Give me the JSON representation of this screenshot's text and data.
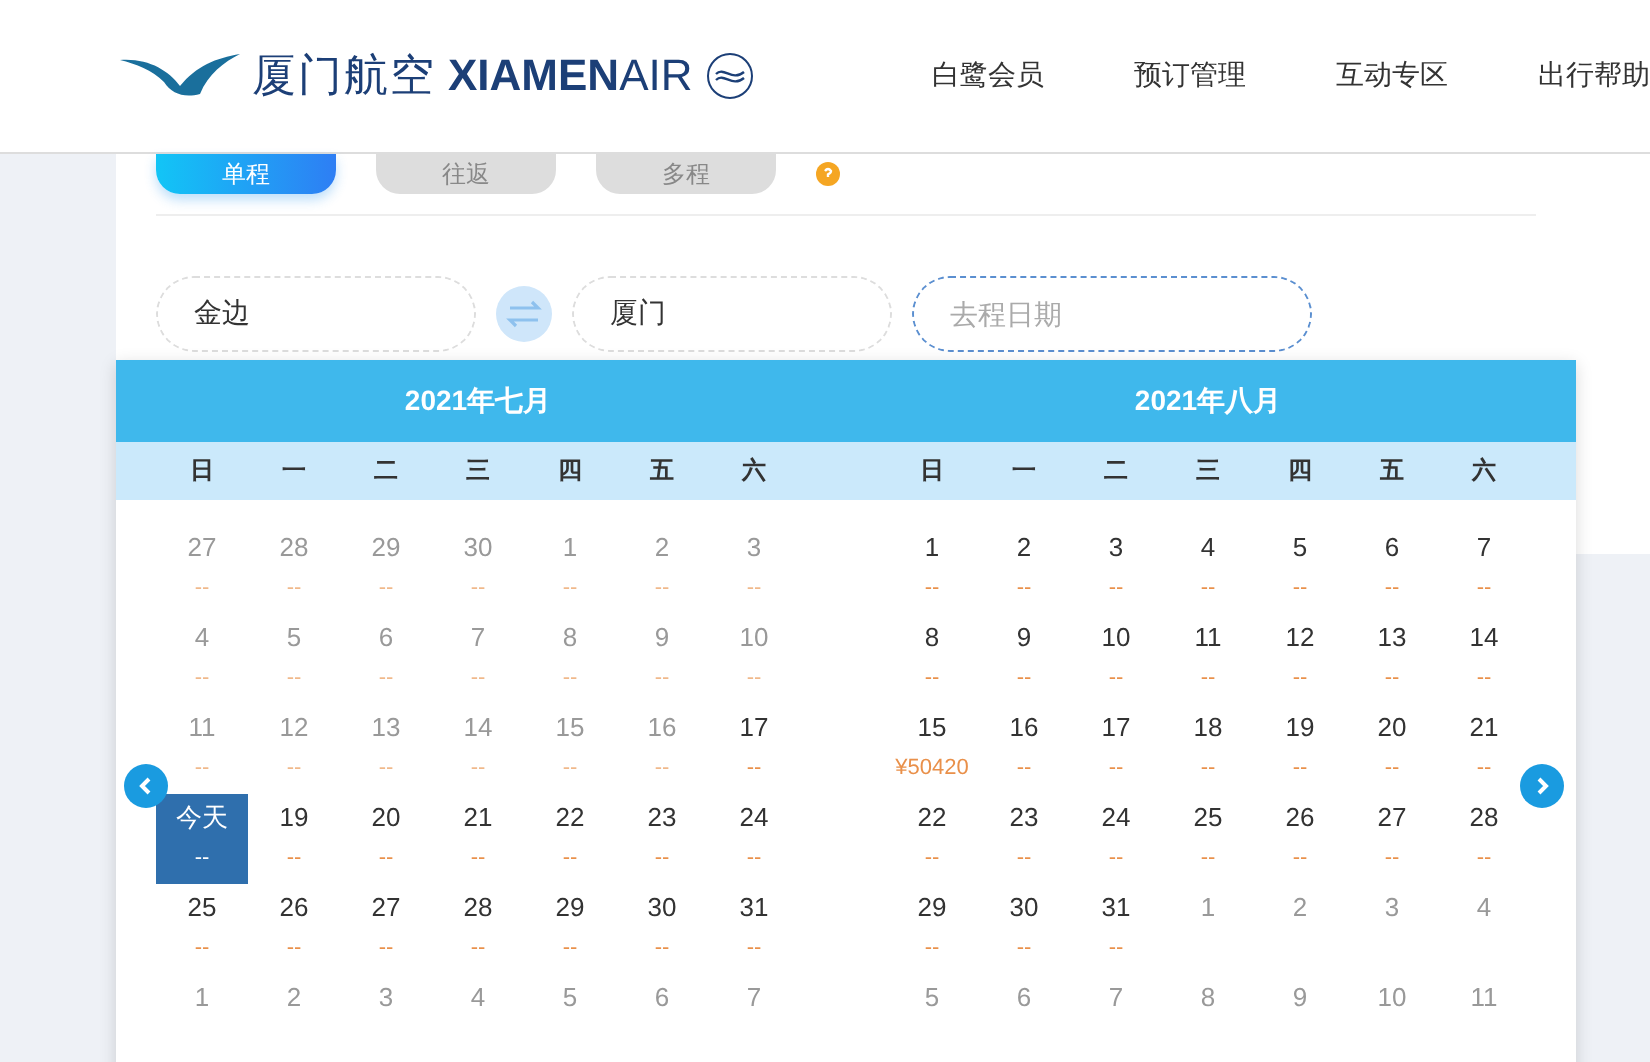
{
  "header": {
    "logo_cn": "厦门航空",
    "logo_en": "**XIAMEN**AIR",
    "nav": [
      "白鹭会员",
      "预订管理",
      "互动专区",
      "出行帮助"
    ]
  },
  "trip_tabs": [
    {
      "label": "单程",
      "selected": true
    },
    {
      "label": "往返",
      "selected": false
    },
    {
      "label": "多程",
      "selected": false
    }
  ],
  "search": {
    "from": "金边",
    "to": "厦门",
    "date": {
      "placeholder": "去程日期"
    }
  },
  "calendar": {
    "months": [
      {
        "title": "2021年七月",
        "weekdays": [
          "日",
          "一",
          "二",
          "三",
          "四",
          "五",
          "六"
        ],
        "weeks": [
          [
            {
              "day": "27",
              "price": "--",
              "kind": "muted"
            },
            {
              "day": "28",
              "price": "--",
              "kind": "muted"
            },
            {
              "day": "29",
              "price": "--",
              "kind": "muted"
            },
            {
              "day": "30",
              "price": "--",
              "kind": "muted"
            },
            {
              "day": "1",
              "price": "--",
              "kind": "muted"
            },
            {
              "day": "2",
              "price": "--",
              "kind": "muted"
            },
            {
              "day": "3",
              "price": "--",
              "kind": "muted"
            }
          ],
          [
            {
              "day": "4",
              "price": "--",
              "kind": "muted"
            },
            {
              "day": "5",
              "price": "--",
              "kind": "muted"
            },
            {
              "day": "6",
              "price": "--",
              "kind": "muted"
            },
            {
              "day": "7",
              "price": "--",
              "kind": "muted"
            },
            {
              "day": "8",
              "price": "--",
              "kind": "muted"
            },
            {
              "day": "9",
              "price": "--",
              "kind": "muted"
            },
            {
              "day": "10",
              "price": "--",
              "kind": "muted"
            }
          ],
          [
            {
              "day": "11",
              "price": "--",
              "kind": "muted"
            },
            {
              "day": "12",
              "price": "--",
              "kind": "muted"
            },
            {
              "day": "13",
              "price": "--",
              "kind": "muted"
            },
            {
              "day": "14",
              "price": "--",
              "kind": "muted"
            },
            {
              "day": "15",
              "price": "--",
              "kind": "muted"
            },
            {
              "day": "16",
              "price": "--",
              "kind": "muted"
            },
            {
              "day": "17",
              "price": "--",
              "kind": "normal"
            }
          ],
          [
            {
              "day": "今天",
              "price": "--",
              "kind": "today"
            },
            {
              "day": "19",
              "price": "--",
              "kind": "normal"
            },
            {
              "day": "20",
              "price": "--",
              "kind": "normal"
            },
            {
              "day": "21",
              "price": "--",
              "kind": "normal"
            },
            {
              "day": "22",
              "price": "--",
              "kind": "normal"
            },
            {
              "day": "23",
              "price": "--",
              "kind": "normal"
            },
            {
              "day": "24",
              "price": "--",
              "kind": "normal"
            }
          ],
          [
            {
              "day": "25",
              "price": "--",
              "kind": "normal"
            },
            {
              "day": "26",
              "price": "--",
              "kind": "normal"
            },
            {
              "day": "27",
              "price": "--",
              "kind": "normal"
            },
            {
              "day": "28",
              "price": "--",
              "kind": "normal"
            },
            {
              "day": "29",
              "price": "--",
              "kind": "normal"
            },
            {
              "day": "30",
              "price": "--",
              "kind": "normal"
            },
            {
              "day": "31",
              "price": "--",
              "kind": "normal"
            }
          ],
          [
            {
              "day": "1",
              "kind": "muted"
            },
            {
              "day": "2",
              "kind": "muted"
            },
            {
              "day": "3",
              "kind": "muted"
            },
            {
              "day": "4",
              "kind": "muted"
            },
            {
              "day": "5",
              "kind": "muted"
            },
            {
              "day": "6",
              "kind": "muted"
            },
            {
              "day": "7",
              "kind": "muted"
            }
          ]
        ]
      },
      {
        "title": "2021年八月",
        "weekdays": [
          "日",
          "一",
          "二",
          "三",
          "四",
          "五",
          "六"
        ],
        "weeks": [
          [
            {
              "day": "1",
              "price": "--",
              "kind": "normal"
            },
            {
              "day": "2",
              "price": "--",
              "kind": "normal"
            },
            {
              "day": "3",
              "price": "--",
              "kind": "normal"
            },
            {
              "day": "4",
              "price": "--",
              "kind": "normal"
            },
            {
              "day": "5",
              "price": "--",
              "kind": "normal"
            },
            {
              "day": "6",
              "price": "--",
              "kind": "normal"
            },
            {
              "day": "7",
              "price": "--",
              "kind": "normal"
            }
          ],
          [
            {
              "day": "8",
              "price": "--",
              "kind": "normal"
            },
            {
              "day": "9",
              "price": "--",
              "kind": "normal"
            },
            {
              "day": "10",
              "price": "--",
              "kind": "normal"
            },
            {
              "day": "11",
              "price": "--",
              "kind": "normal"
            },
            {
              "day": "12",
              "price": "--",
              "kind": "normal"
            },
            {
              "day": "13",
              "price": "--",
              "kind": "normal"
            },
            {
              "day": "14",
              "price": "--",
              "kind": "normal"
            }
          ],
          [
            {
              "day": "15",
              "price": "¥50420",
              "kind": "normal"
            },
            {
              "day": "16",
              "price": "--",
              "kind": "normal"
            },
            {
              "day": "17",
              "price": "--",
              "kind": "normal"
            },
            {
              "day": "18",
              "price": "--",
              "kind": "normal"
            },
            {
              "day": "19",
              "price": "--",
              "kind": "normal"
            },
            {
              "day": "20",
              "price": "--",
              "kind": "normal"
            },
            {
              "day": "21",
              "price": "--",
              "kind": "normal"
            }
          ],
          [
            {
              "day": "22",
              "price": "--",
              "kind": "normal"
            },
            {
              "day": "23",
              "price": "--",
              "kind": "normal"
            },
            {
              "day": "24",
              "price": "--",
              "kind": "normal"
            },
            {
              "day": "25",
              "price": "--",
              "kind": "normal"
            },
            {
              "day": "26",
              "price": "--",
              "kind": "normal"
            },
            {
              "day": "27",
              "price": "--",
              "kind": "normal"
            },
            {
              "day": "28",
              "price": "--",
              "kind": "normal"
            }
          ],
          [
            {
              "day": "29",
              "price": "--",
              "kind": "normal"
            },
            {
              "day": "30",
              "price": "--",
              "kind": "normal"
            },
            {
              "day": "31",
              "price": "--",
              "kind": "normal"
            },
            {
              "day": "1",
              "kind": "muted"
            },
            {
              "day": "2",
              "kind": "muted"
            },
            {
              "day": "3",
              "kind": "muted"
            },
            {
              "day": "4",
              "kind": "muted"
            }
          ],
          [
            {
              "day": "5",
              "kind": "muted"
            },
            {
              "day": "6",
              "kind": "muted"
            },
            {
              "day": "7",
              "kind": "muted"
            },
            {
              "day": "8",
              "kind": "muted"
            },
            {
              "day": "9",
              "kind": "muted"
            },
            {
              "day": "10",
              "kind": "muted"
            },
            {
              "day": "11",
              "kind": "muted"
            }
          ]
        ]
      }
    ]
  }
}
